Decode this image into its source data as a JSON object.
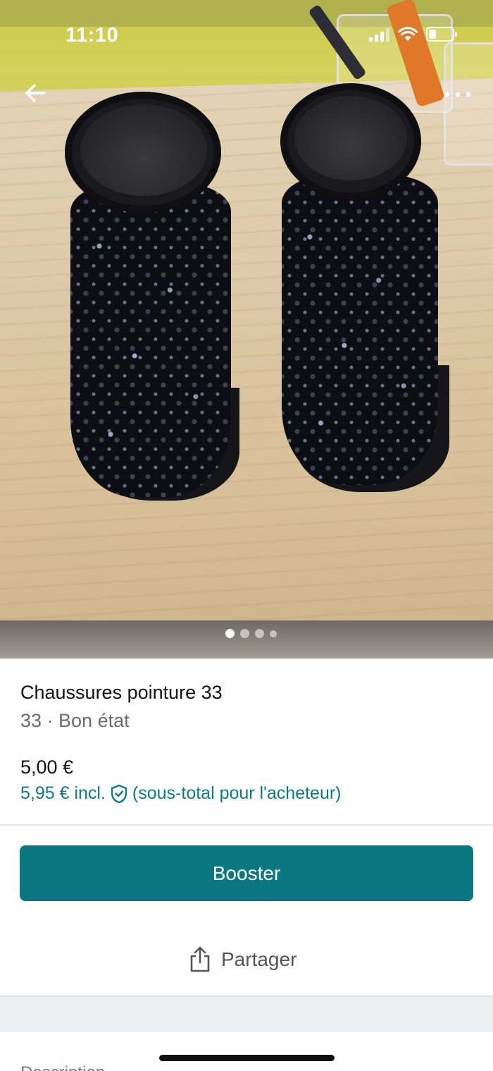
{
  "status_bar": {
    "time": "11:10"
  },
  "nav": {
    "back_icon": "arrow-left-icon",
    "more_icon": "more-horizontal-icon"
  },
  "gallery": {
    "image_count": 4,
    "active_index": 0
  },
  "item": {
    "title": "Chaussures pointure 33",
    "subtitle": "33 · Bon état",
    "price": "5,00 €",
    "price_incl": "5,95 € incl.",
    "price_incl_note": "(sous-total pour l'acheteur)"
  },
  "actions": {
    "booster_label": "Booster",
    "share_label": "Partager"
  },
  "description": {
    "label": "Description"
  },
  "colors": {
    "accent": "#0b7780",
    "link": "#0d7a84"
  }
}
